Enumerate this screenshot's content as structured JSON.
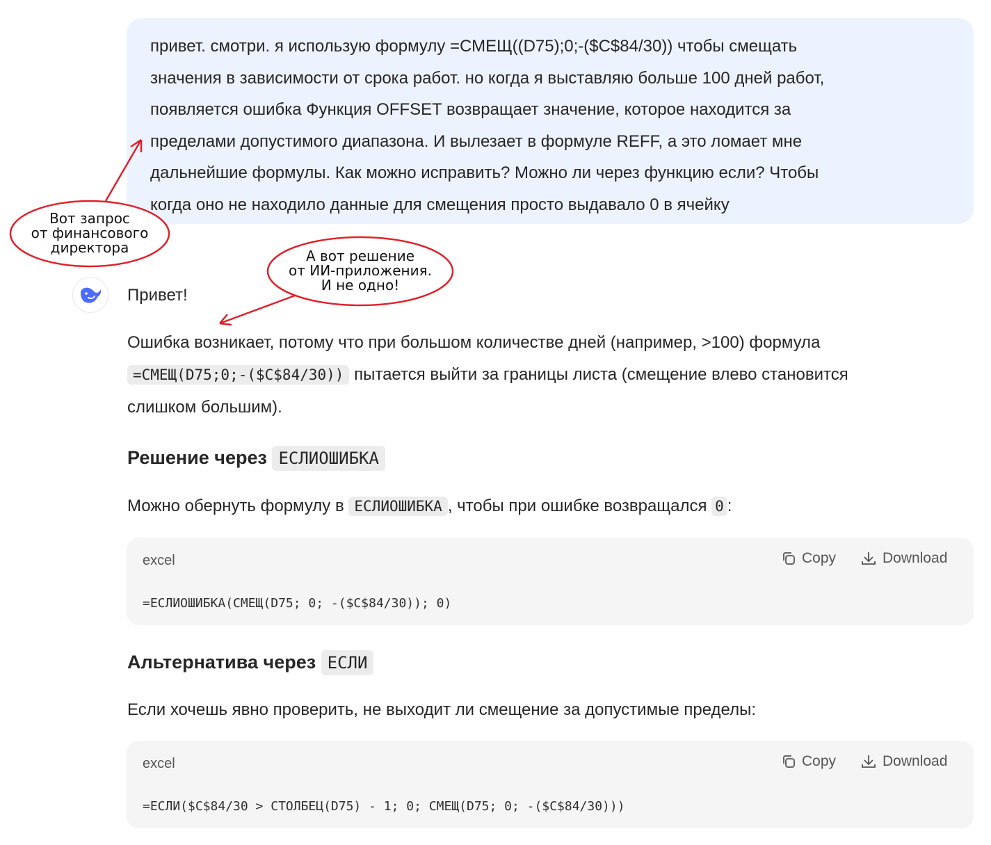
{
  "user_message": {
    "lines": [
      "привет. смотри. я использую формулу =СМЕЩ((D75);0;-($C$84/30)) чтобы смещать",
      "значения в зависимости от срока работ. но когда я выставляю больше 100 дней работ,",
      "появляется ошибка Функция OFFSET возвращает значение, которое находится за",
      "пределами допустимого диапазона. И вылезает в формуле REFF, а это ломает мне",
      "дальнейшие формулы. Как можно исправить? Можно ли через функцию если? Чтобы",
      "когда оно не находило данные для смещения просто выдавало 0 в ячейку"
    ]
  },
  "callouts": {
    "left": {
      "line1": "Вот запрос",
      "line2": "от финансового",
      "line3": "директора"
    },
    "right": {
      "line1": "А вот решение",
      "line2": "от ИИ-приложения.",
      "line3": "И не одно!"
    },
    "color": "#e0212a"
  },
  "assistant": {
    "avatar_icon": "whale-icon",
    "greeting": "Привет!",
    "intro": {
      "part1": "Ошибка возникает, потому что при большом количестве дней (например, >100) формула",
      "code": "=СМЕЩ(D75;0;-($C$84/30))",
      "part2": "пытается выйти за границы листа (смещение влево становится",
      "part3": "слишком большим)."
    },
    "section1": {
      "heading": "Решение через",
      "heading_code": "ЕСЛИОШИБКА",
      "text_before": "Можно обернуть формулу в",
      "text_code": "ЕСЛИОШИБКА",
      "text_middle": ", чтобы при ошибке возвращался",
      "text_code2": "0",
      "text_after": ":",
      "code_lang": "excel",
      "copy_label": "Copy",
      "download_label": "Download",
      "code": "=ЕСЛИОШИБКА(СМЕЩ(D75; 0; -($C$84/30)); 0)"
    },
    "section2": {
      "heading": "Альтернатива через",
      "heading_code": "ЕСЛИ",
      "text": "Если хочешь явно проверить, не выходит ли смещение за допустимые пределы:",
      "code_lang": "excel",
      "copy_label": "Copy",
      "download_label": "Download",
      "code": "=ЕСЛИ($C$84/30 > СТОЛБЕЦ(D75) - 1; 0; СМЕЩ(D75; 0; -($C$84/30)))"
    }
  }
}
